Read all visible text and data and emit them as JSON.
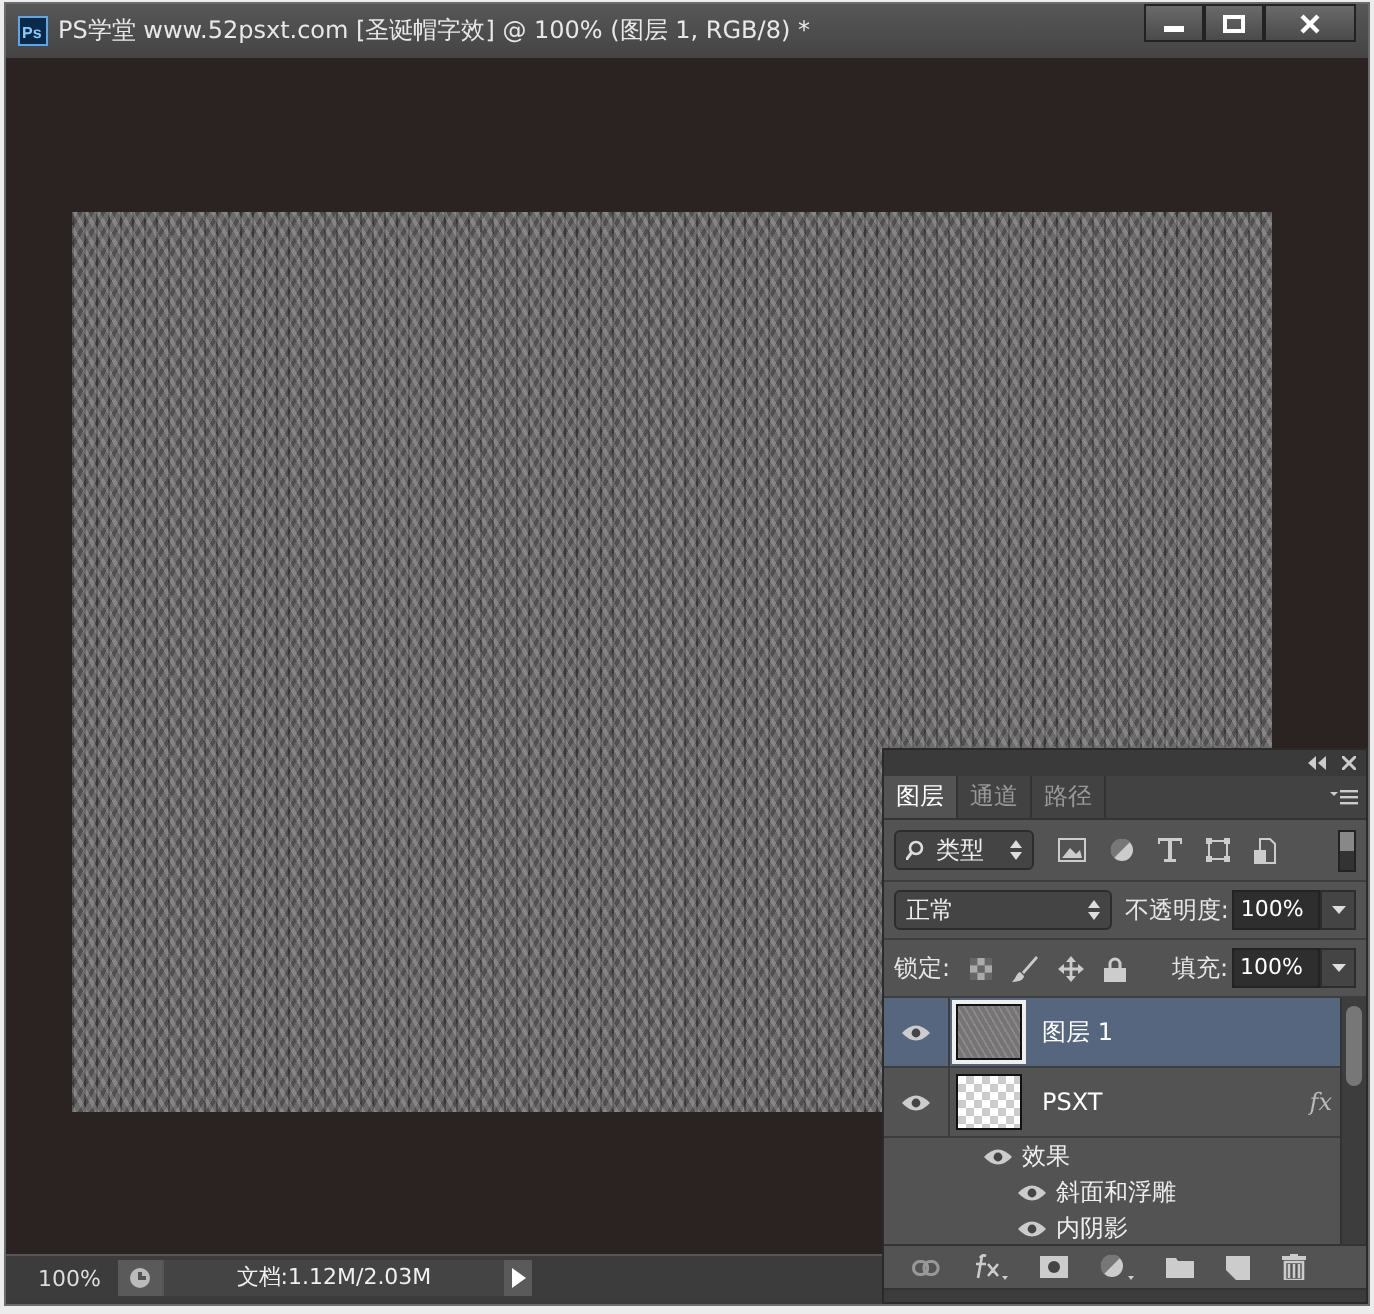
{
  "window": {
    "app_logo": "Ps",
    "title": "PS学堂 www.52psxt.com [圣诞帽字效] @ 100% (图层 1, RGB/8) *"
  },
  "layers_panel": {
    "tabs": [
      {
        "label": "图层",
        "selected": true
      },
      {
        "label": "通道",
        "selected": false
      },
      {
        "label": "路径",
        "selected": false
      }
    ],
    "filter": {
      "value": "类型"
    },
    "blend_mode": {
      "value": "正常"
    },
    "opacity": {
      "label": "不透明度:",
      "value": "100%"
    },
    "lock": {
      "label": "锁定:"
    },
    "fill": {
      "label": "填充:",
      "value": "100%"
    },
    "layers": [
      {
        "name": "图层 1",
        "selected": true,
        "kind": "image"
      },
      {
        "name": "PSXT",
        "selected": false,
        "kind": "transparent",
        "fx": "fx",
        "children": [
          {
            "name": "效果",
            "children": [
              {
                "name": "斜面和浮雕"
              },
              {
                "name": "内阴影"
              }
            ]
          }
        ]
      }
    ]
  },
  "status_bar": {
    "zoom": "100%",
    "doc_info": "文档:1.12M/2.03M"
  }
}
